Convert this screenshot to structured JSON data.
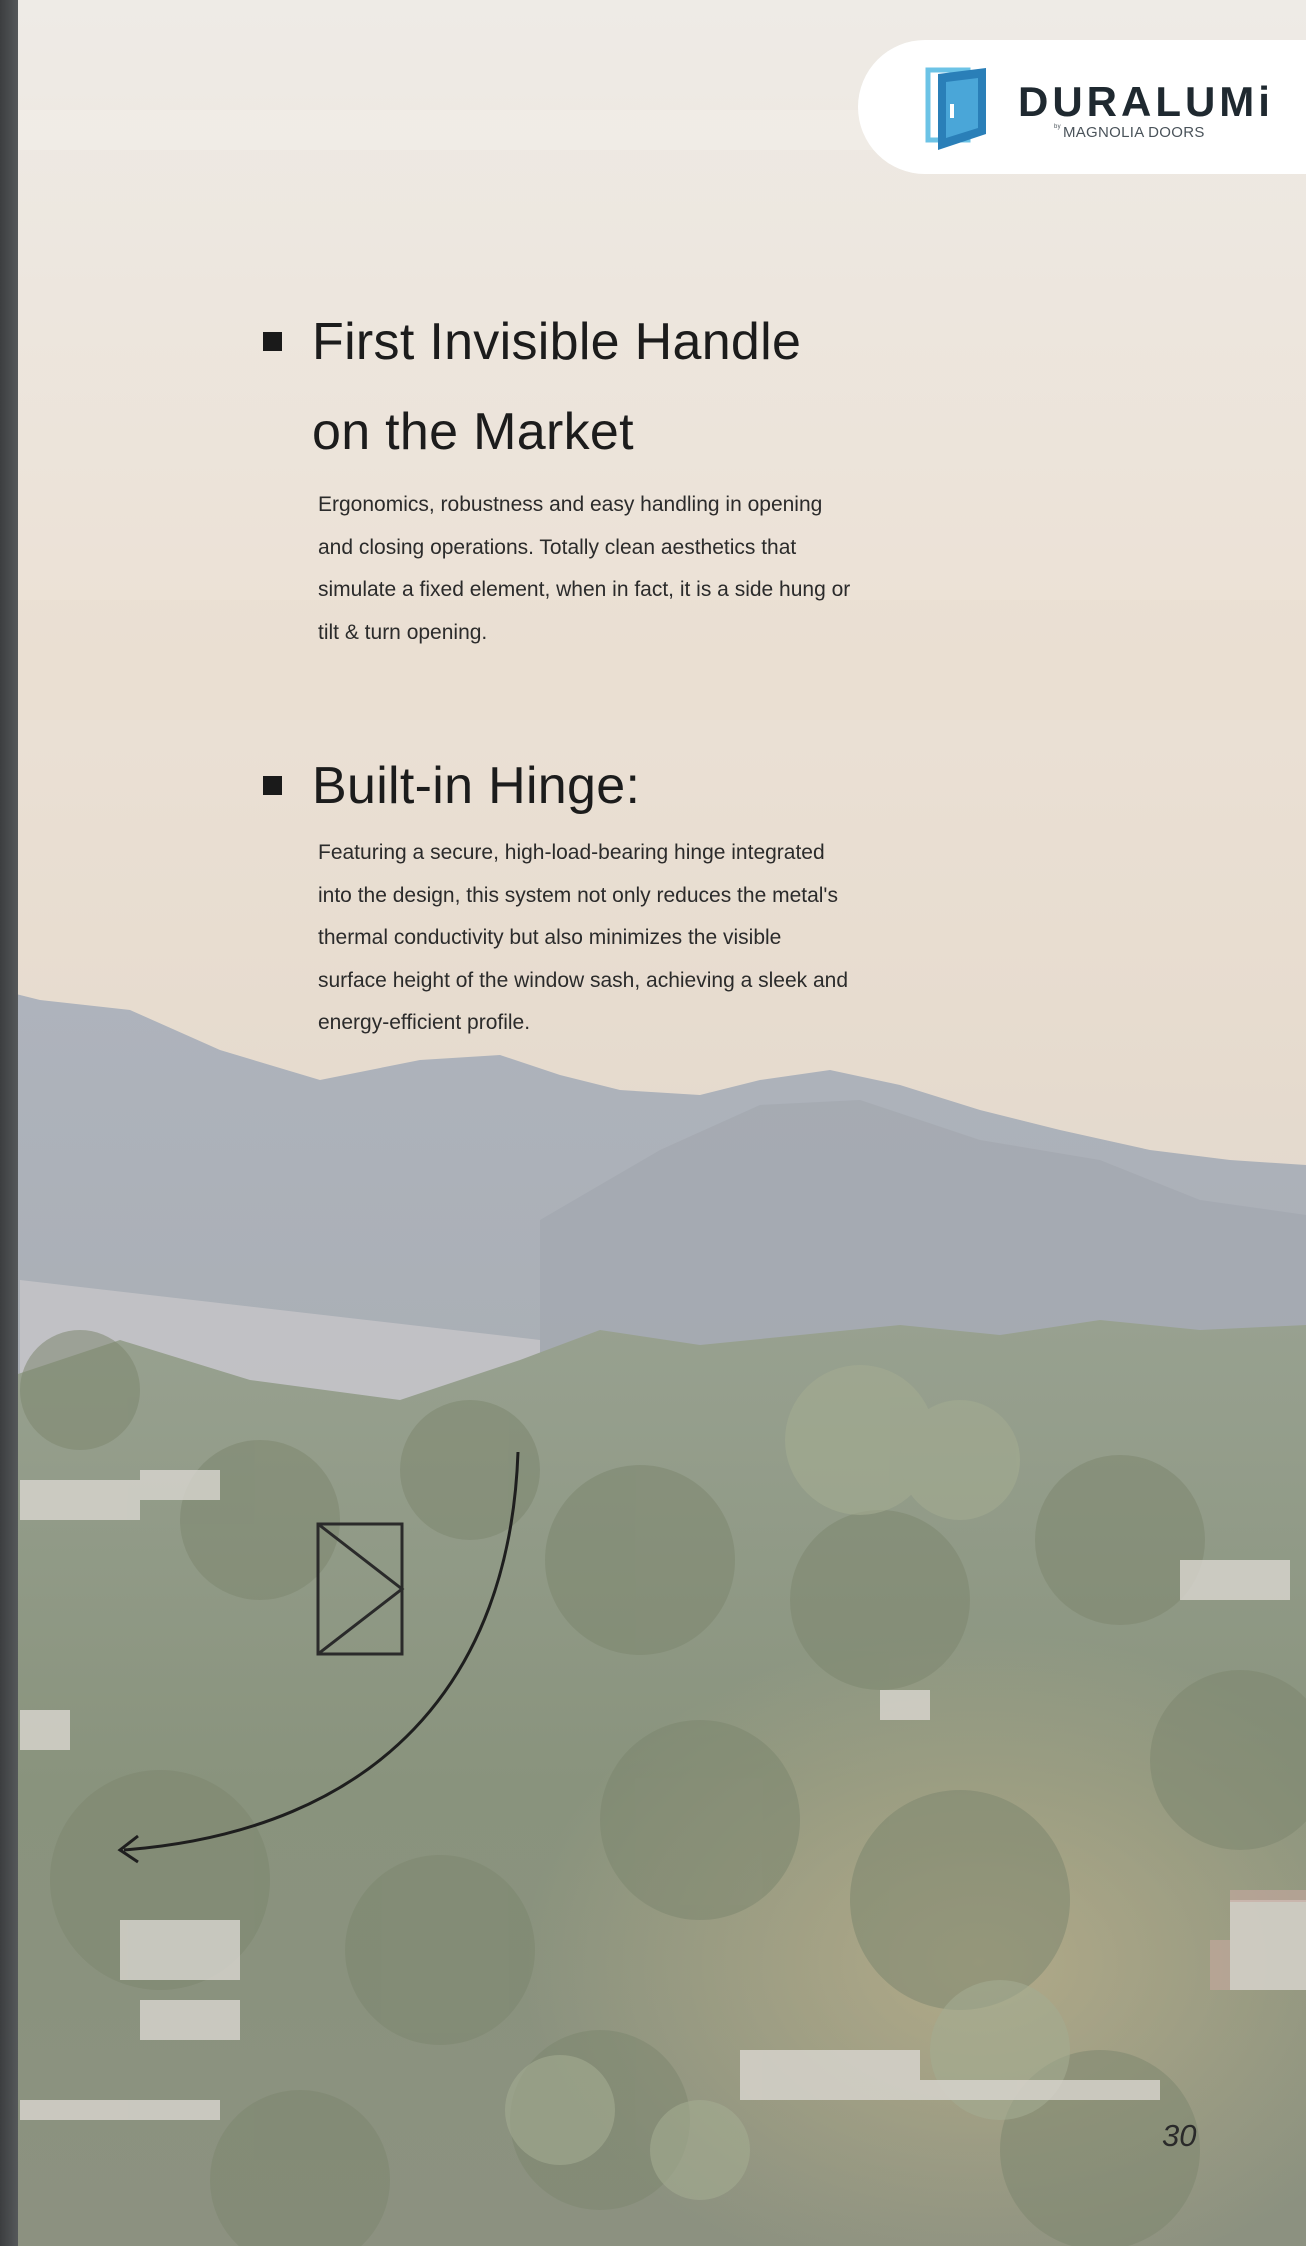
{
  "brand": {
    "name": "DURALUMi",
    "by": "by",
    "sub": "MAGNOLIA DOORS",
    "colors": {
      "icon_dark": "#2a7fb8",
      "icon_light": "#6cc3e6",
      "text": "#1f2930"
    }
  },
  "sections": [
    {
      "title_line1": "First Invisible Handle",
      "title_line2": "on the Market",
      "body": [
        "Ergonomics, robustness and easy handling in opening",
        "and closing operations. Totally clean aesthetics that",
        "simulate a fixed element, when in fact, it is a side hung or",
        "tilt & turn opening."
      ]
    },
    {
      "title_line1": "Built-in Hinge:",
      "body": [
        "Featuring a secure, high-load-bearing hinge integrated",
        "into the design, this system not only reduces the metal's",
        "thermal conductivity but also minimizes the visible",
        "surface height of the window sash, achieving a sleek and",
        "energy-efficient profile."
      ]
    }
  ],
  "diagram": {
    "icon": "side-hung-opening-icon",
    "arrow": "swing-arc-arrow"
  },
  "page_number": "30"
}
